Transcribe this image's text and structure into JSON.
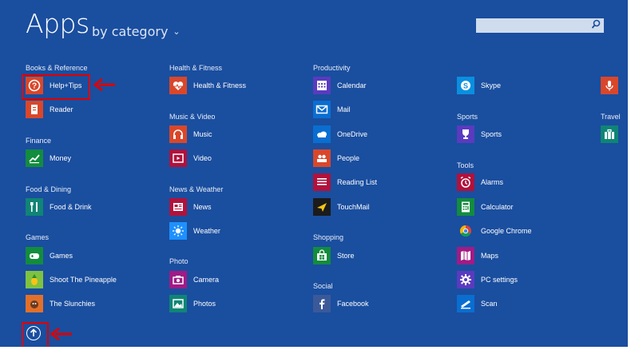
{
  "header": {
    "title": "Apps",
    "sort_label": "by category"
  },
  "search": {
    "placeholder": ""
  },
  "colors": {
    "background": "#1a4e9f",
    "highlight": "#e00000"
  },
  "categories": [
    {
      "label": "Books & Reference",
      "apps": [
        {
          "name": "Help+Tips",
          "icon": "help-icon",
          "color": "#d9472b"
        },
        {
          "name": "Reader",
          "icon": "reader-icon",
          "color": "#d9472b"
        }
      ]
    },
    {
      "label": "Finance",
      "apps": [
        {
          "name": "Money",
          "icon": "money-icon",
          "color": "#128c3e"
        }
      ]
    },
    {
      "label": "Food & Dining",
      "apps": [
        {
          "name": "Food & Drink",
          "icon": "food-icon",
          "color": "#0f8575"
        }
      ]
    },
    {
      "label": "Games",
      "apps": [
        {
          "name": "Games",
          "icon": "gamepad-icon",
          "color": "#128c3e"
        },
        {
          "name": "Shoot The Pineapple",
          "icon": "pineapple-icon",
          "color": "#7fc241"
        },
        {
          "name": "The Slunchies",
          "icon": "slunchies-icon",
          "color": "#e2702a"
        }
      ]
    },
    {
      "label": "Health & Fitness",
      "apps": [
        {
          "name": "Health & Fitness",
          "icon": "heart-icon",
          "color": "#d9472b"
        }
      ]
    },
    {
      "label": "Music & Video",
      "apps": [
        {
          "name": "Music",
          "icon": "headphones-icon",
          "color": "#d9472b"
        },
        {
          "name": "Video",
          "icon": "video-icon",
          "color": "#b0123d"
        }
      ]
    },
    {
      "label": "News & Weather",
      "apps": [
        {
          "name": "News",
          "icon": "news-icon",
          "color": "#b0123d"
        },
        {
          "name": "Weather",
          "icon": "sun-icon",
          "color": "#1e90ff"
        }
      ]
    },
    {
      "label": "Photo",
      "apps": [
        {
          "name": "Camera",
          "icon": "camera-icon",
          "color": "#a01b86"
        },
        {
          "name": "Photos",
          "icon": "photos-icon",
          "color": "#0f8575"
        }
      ]
    },
    {
      "label": "Productivity",
      "apps": [
        {
          "name": "Calendar",
          "icon": "calendar-icon",
          "color": "#5a3bbf"
        },
        {
          "name": "Mail",
          "icon": "mail-icon",
          "color": "#0a6ed1"
        },
        {
          "name": "OneDrive",
          "icon": "cloud-icon",
          "color": "#0a6ed1"
        },
        {
          "name": "People",
          "icon": "people-icon",
          "color": "#d9472b"
        },
        {
          "name": "Reading List",
          "icon": "reading-list-icon",
          "color": "#b0123d"
        },
        {
          "name": "TouchMail",
          "icon": "touchmail-icon",
          "color": "#1b1b1b"
        }
      ]
    },
    {
      "label": "Shopping",
      "apps": [
        {
          "name": "Store",
          "icon": "store-icon",
          "color": "#128c3e"
        }
      ]
    },
    {
      "label": "Social",
      "apps": [
        {
          "name": "Facebook",
          "icon": "facebook-icon",
          "color": "#3b5998"
        }
      ]
    },
    {
      "label": "",
      "apps": [
        {
          "name": "Skype",
          "icon": "skype-icon",
          "color": "#0a8fe0"
        }
      ]
    },
    {
      "label": "Sports",
      "apps": [
        {
          "name": "Sports",
          "icon": "trophy-icon",
          "color": "#5a3bbf"
        }
      ]
    },
    {
      "label": "Tools",
      "apps": [
        {
          "name": "Alarms",
          "icon": "alarm-icon",
          "color": "#b0123d"
        },
        {
          "name": "Calculator",
          "icon": "calculator-icon",
          "color": "#128c3e"
        },
        {
          "name": "Google Chrome",
          "icon": "chrome-icon",
          "color": "#1a4e9f"
        },
        {
          "name": "Maps",
          "icon": "maps-icon",
          "color": "#a01b86"
        },
        {
          "name": "PC settings",
          "icon": "gear-icon",
          "color": "#5a3bbf"
        },
        {
          "name": "Scan",
          "icon": "scan-icon",
          "color": "#0a6ed1"
        }
      ]
    },
    {
      "label": "",
      "apps": [
        {
          "name": "",
          "icon": "microphone-icon",
          "color": "#d9472b"
        }
      ]
    },
    {
      "label": "Travel",
      "apps": [
        {
          "name": "",
          "icon": "travel-icon",
          "color": "#0f8575"
        }
      ]
    }
  ]
}
